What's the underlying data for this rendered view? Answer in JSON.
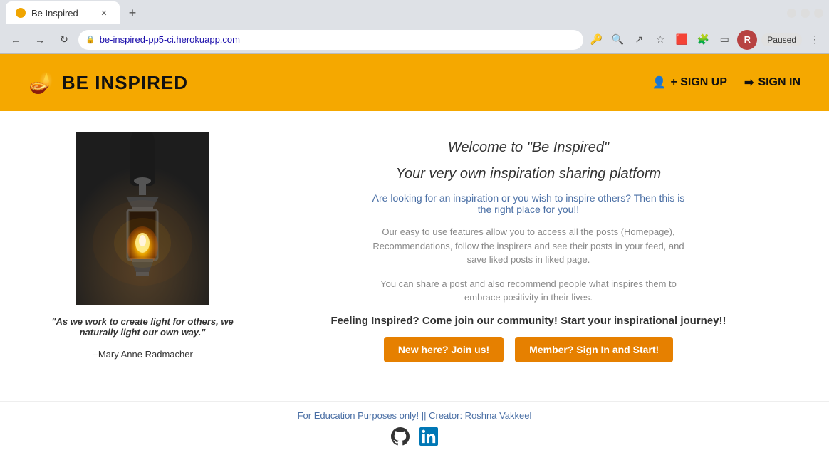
{
  "browser": {
    "tab_title": "Be Inspired",
    "address": "be-inspired-pp5-ci.herokuapp.com",
    "profile_initial": "R",
    "paused_label": "Paused",
    "new_tab_symbol": "+",
    "back_symbol": "←",
    "forward_symbol": "→",
    "refresh_symbol": "↻"
  },
  "navbar": {
    "logo_text": "BE INSPIRED",
    "signup_label": "+ SIGN UP",
    "signin_label": "SIGN IN"
  },
  "main": {
    "quote_text": "\"As we work to create light for others, we naturally light our own way.\"",
    "quote_author": "--Mary Anne Radmacher",
    "welcome_title": "Welcome to \"Be Inspired\"",
    "welcome_sub": "Your very own inspiration sharing platform",
    "desc1": "Are looking for an inspiration or you wish to inspire others? Then this is the right place for you!!",
    "desc2": "Our easy to use features allow you to access all the posts (Homepage), Recommendations, follow the inspirers and see their posts in your feed, and save liked posts in liked page.",
    "desc3": "You can share a post and also recommend people what inspires them to embrace positivity in their lives.",
    "cta_text": "Feeling Inspired? Come join our community! Start your inspirational journey!!",
    "btn_join": "New here? Join us!",
    "btn_signin": "Member? Sign In and Start!"
  },
  "footer": {
    "text": "For Education Purposes only! || Creator: Roshna Vakkeel",
    "github_label": "GitHub",
    "linkedin_label": "LinkedIn"
  }
}
